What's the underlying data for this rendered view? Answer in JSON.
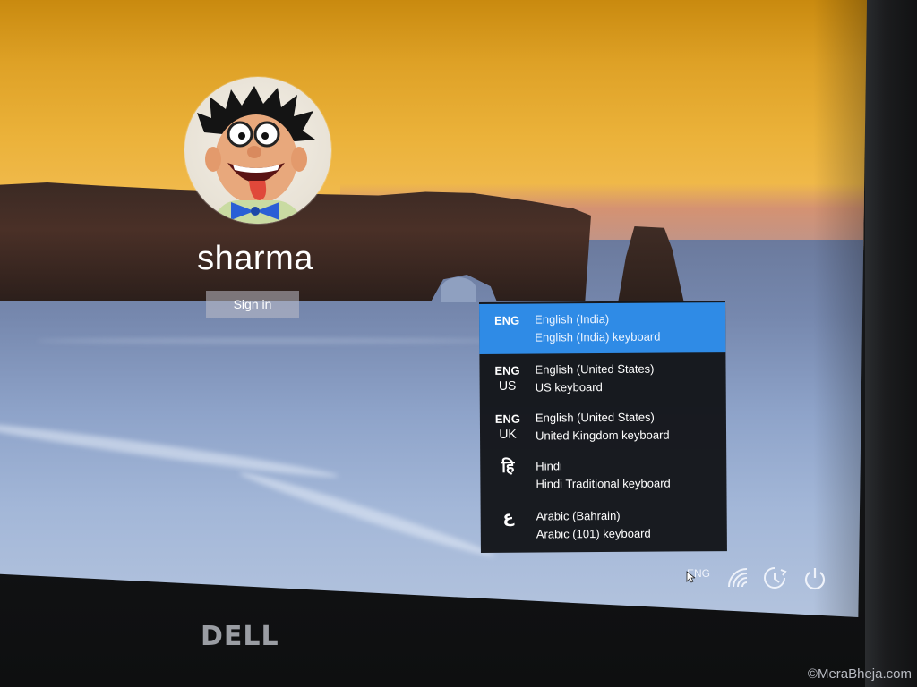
{
  "user": {
    "name": "sharma",
    "sign_in_label": "Sign in"
  },
  "language_flyout": {
    "items": [
      {
        "code": "ENG",
        "code_sub": "",
        "name": "English (India)",
        "keyboard": "English (India) keyboard",
        "selected": true
      },
      {
        "code": "ENG",
        "code_sub": "US",
        "name": "English (United States)",
        "keyboard": "US keyboard",
        "selected": false
      },
      {
        "code": "ENG",
        "code_sub": "UK",
        "name": "English (United States)",
        "keyboard": "United Kingdom keyboard",
        "selected": false
      },
      {
        "code": "हि",
        "code_sub": "",
        "name": "Hindi",
        "keyboard": "Hindi Traditional keyboard",
        "selected": false
      },
      {
        "code": "ع",
        "code_sub": "",
        "name": "Arabic (Bahrain)",
        "keyboard": "Arabic (101) keyboard",
        "selected": false
      }
    ]
  },
  "tray": {
    "input_indicator": "ENG",
    "icons": [
      "network-wifi-icon",
      "ease-of-access-icon",
      "power-icon"
    ]
  },
  "bezel": {
    "brand": "DELL",
    "watermark": "©MeraBheja.com"
  },
  "colors": {
    "accent": "#2f8be6",
    "flyout_bg": "#14161a"
  }
}
